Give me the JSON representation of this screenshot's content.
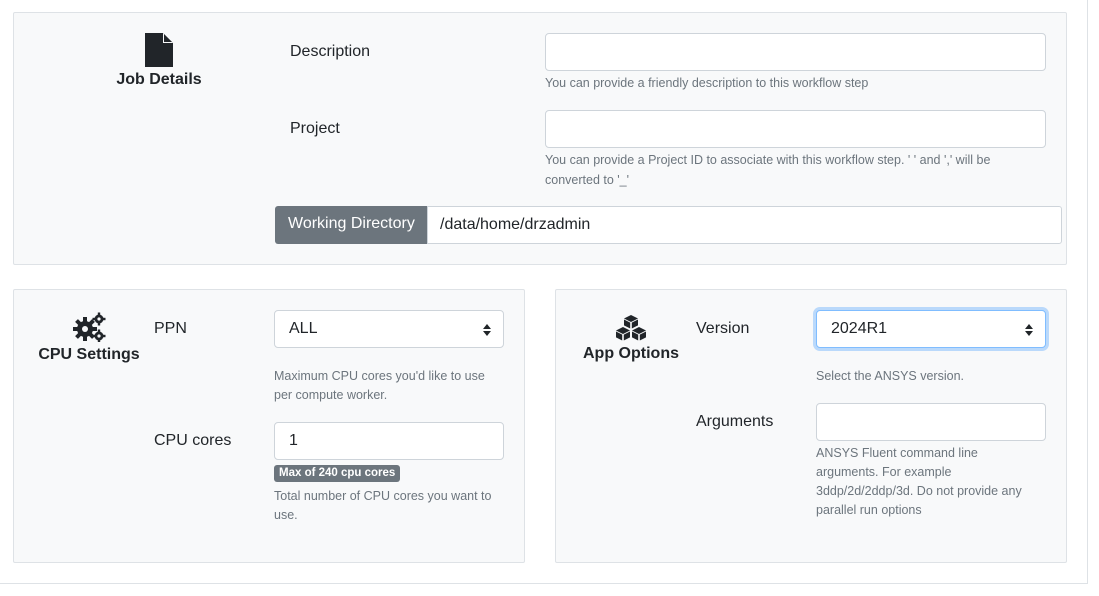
{
  "job_details": {
    "title": "Job Details",
    "icon": "file-icon",
    "description": {
      "label": "Description",
      "value": "",
      "help": "You can provide a friendly description to this workflow step"
    },
    "project": {
      "label": "Project",
      "value": "",
      "help_line1": "You can provide a Project ID to associate with this workflow step. ' ' and ',' will be",
      "help_line2": "converted to '_'"
    },
    "working_directory": {
      "label": "Working Directory",
      "value": "/data/home/drzadmin"
    }
  },
  "cpu_settings": {
    "title": "CPU Settings",
    "icon": "gears-icon",
    "ppn": {
      "label": "PPN",
      "value": "ALL",
      "help_line1": "Maximum CPU cores you'd like to use",
      "help_line2": "per compute worker."
    },
    "cpu_cores": {
      "label": "CPU cores",
      "value": "1",
      "badge": "Max of 240 cpu cores",
      "help_line1": "Total number of CPU cores you want to",
      "help_line2": "use."
    }
  },
  "app_options": {
    "title": "App Options",
    "icon": "cubes-icon",
    "version": {
      "label": "Version",
      "value": "2024R1",
      "help": "Select the ANSYS version."
    },
    "arguments": {
      "label": "Arguments",
      "value": "",
      "help_line1": "ANSYS Fluent command line",
      "help_line2": "arguments. For example",
      "help_line3": "3ddp/2d/2ddp/3d. Do not provide any",
      "help_line4": "parallel run options"
    }
  },
  "colors": {
    "panel_bg": "#f8f9fa",
    "badge_bg": "#6c757d",
    "focus_border": "#80bdff"
  }
}
